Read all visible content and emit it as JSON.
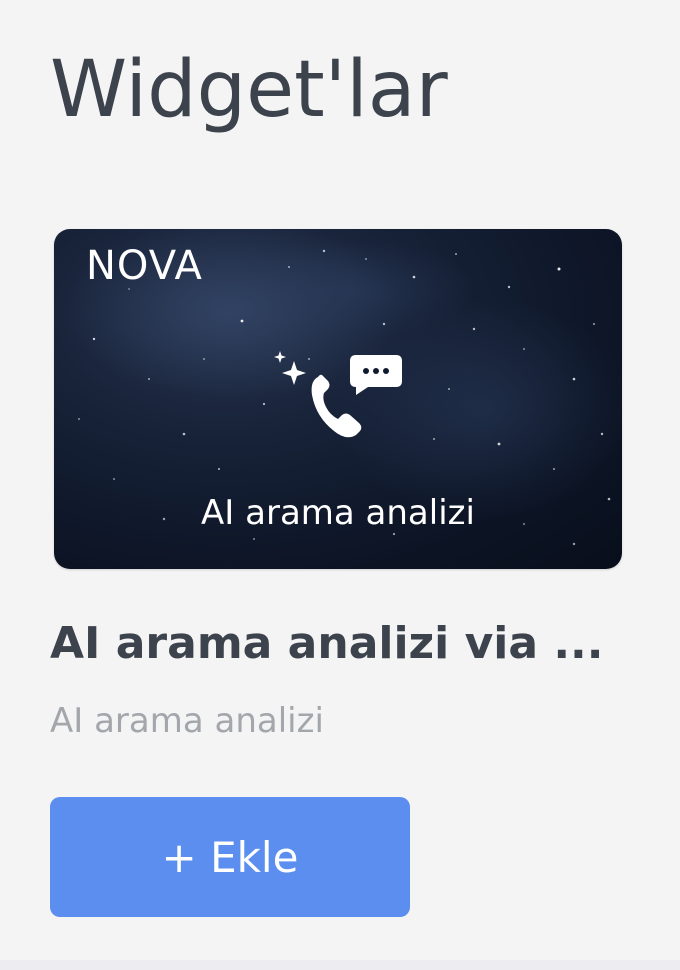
{
  "page": {
    "title": "Widget'lar"
  },
  "widget": {
    "brand": "NOVA",
    "card_caption": "AI arama analizi",
    "name": "AI arama analizi via ...",
    "subtitle": "AI arama analizi",
    "icon": "sparkle-phone-chat-icon",
    "add_label": "+ Ekle"
  },
  "colors": {
    "background": "#f4f4f5",
    "title_text": "#3d434c",
    "subtitle_text": "#a3a6ab",
    "button_bg": "#5b8eee",
    "card_bg": "#0d1526"
  }
}
